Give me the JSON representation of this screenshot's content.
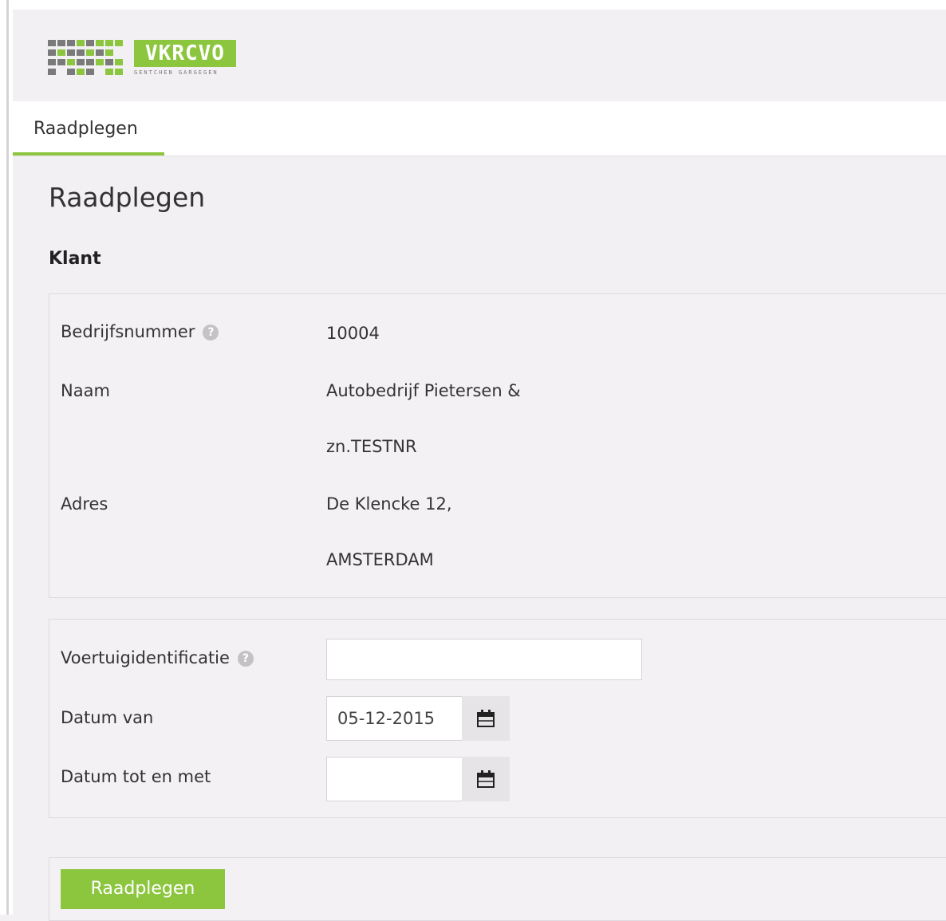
{
  "logo": {
    "brand": "VKRCVO",
    "tagline": "GENTCHEN GARGEGEN"
  },
  "nav": {
    "tab_label": "Raadplegen"
  },
  "page": {
    "title": "Raadplegen"
  },
  "klant": {
    "section_title": "Klant",
    "bedrijfsnummer_label": "Bedrijfsnummer",
    "bedrijfsnummer_value": "10004",
    "naam_label": "Naam",
    "naam_line1": "Autobedrijf Pietersen &",
    "naam_line2": "zn.TESTNR",
    "adres_label": "Adres",
    "adres_line1": "De Klencke 12,",
    "adres_line2": "AMSTERDAM"
  },
  "filter": {
    "voertuig_label": "Voertuigidentificatie",
    "voertuig_value": "",
    "datum_van_label": "Datum van",
    "datum_van_value": "05-12-2015",
    "datum_tot_label": "Datum tot en met",
    "datum_tot_value": ""
  },
  "actions": {
    "submit_label": "Raadplegen"
  },
  "icons": {
    "help": "help-icon",
    "calendar": "calendar-icon"
  },
  "colors": {
    "accent": "#8cc63f",
    "background": "#f3f0f4"
  }
}
